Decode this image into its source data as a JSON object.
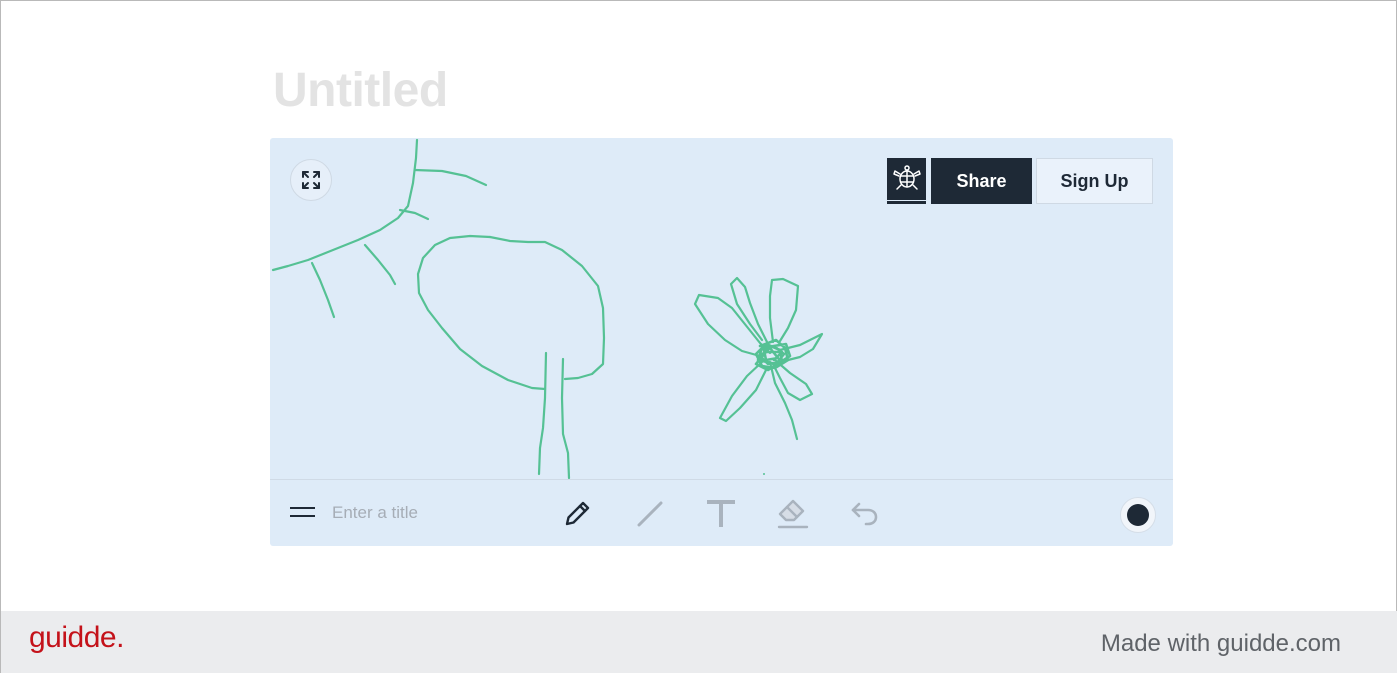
{
  "document": {
    "title": "Untitled"
  },
  "board": {
    "share_label": "Share",
    "signup_label": "Sign Up",
    "toolbar": {
      "title_placeholder": "Enter a title",
      "title_value": "",
      "active_tool": "pencil",
      "tools": [
        "pencil",
        "line",
        "text",
        "eraser",
        "undo"
      ],
      "current_color": "#1e2936"
    },
    "stroke_color": "#55c194",
    "background_color": "#deebf8"
  },
  "icons": {
    "expand": "expand-icon",
    "logo": "turtle-icon",
    "menu": "menu-icon",
    "pencil": "pencil-icon",
    "line": "line-icon",
    "text": "text-icon",
    "eraser": "eraser-icon",
    "undo": "undo-icon"
  },
  "footer": {
    "brand": "guidde.",
    "made_with": "Made with guidde.com"
  }
}
